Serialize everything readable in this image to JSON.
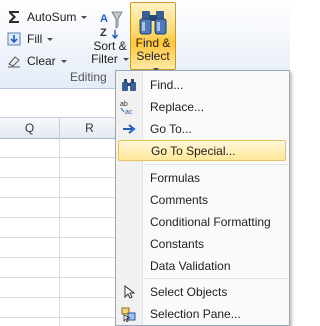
{
  "ribbon": {
    "editing": {
      "autosum_label": "AutoSum",
      "fill_label": "Fill",
      "clear_label": "Clear",
      "group_label": "Editing"
    },
    "sort_filter": {
      "line1": "Sort &",
      "line2": "Filter"
    },
    "find_select": {
      "line1": "Find &",
      "line2": "Select"
    }
  },
  "sheet": {
    "columns": [
      "Q",
      "R"
    ]
  },
  "menu": {
    "items": [
      {
        "label": "Find...",
        "icon": "binoculars-icon"
      },
      {
        "label": "Replace...",
        "icon": "replace-icon"
      },
      {
        "label": "Go To...",
        "icon": "arrow-right-icon"
      },
      {
        "label": "Go To Special...",
        "icon": ""
      },
      {
        "label": "Formulas",
        "icon": ""
      },
      {
        "label": "Comments",
        "icon": ""
      },
      {
        "label": "Conditional Formatting",
        "icon": ""
      },
      {
        "label": "Constants",
        "icon": ""
      },
      {
        "label": "Data Validation",
        "icon": ""
      },
      {
        "label": "Select Objects",
        "icon": "cursor-icon"
      },
      {
        "label": "Selection Pane...",
        "icon": "selection-pane-icon"
      }
    ],
    "highlighted": "Go To Special..."
  },
  "colors": {
    "highlight": "#ffe79a",
    "accent": "#1f5fbf"
  }
}
